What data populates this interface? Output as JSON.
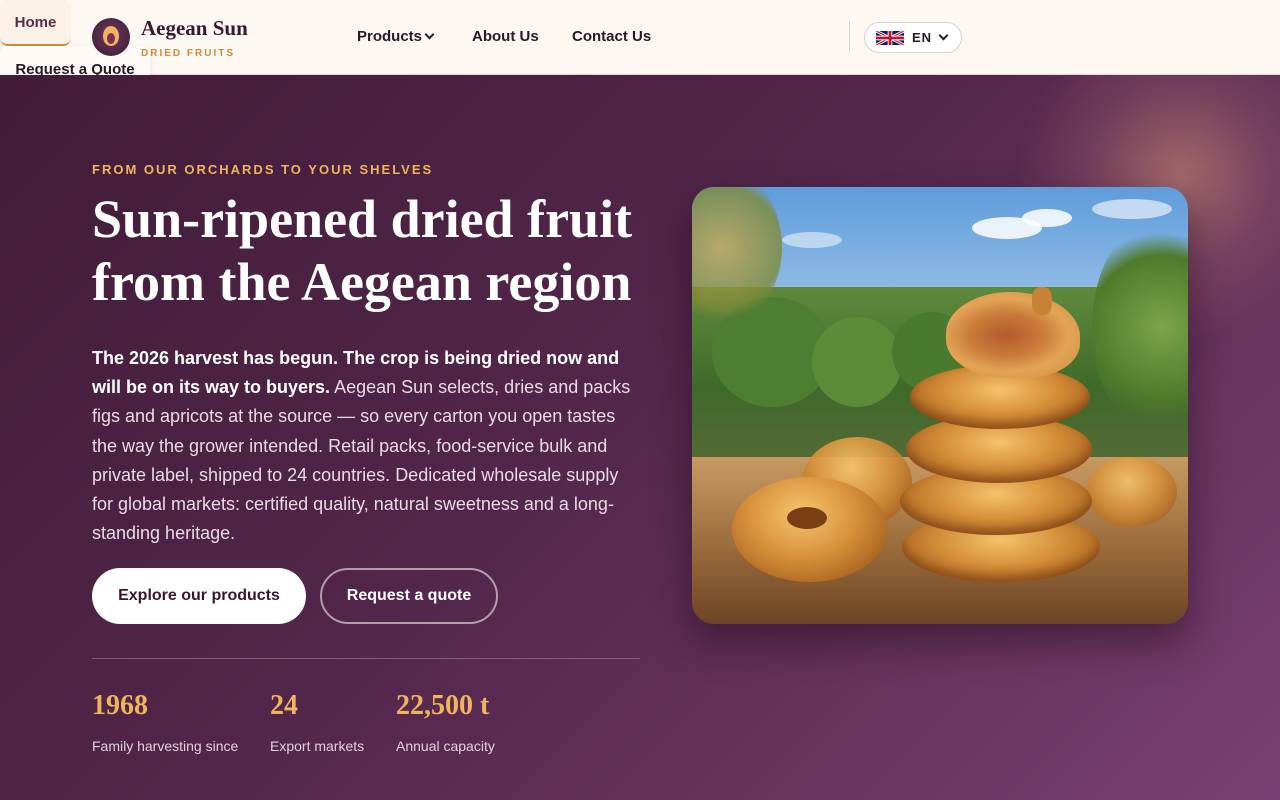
{
  "brand": {
    "name": "Aegean Sun",
    "subtitle": "DRIED FRUITS"
  },
  "nav": {
    "home": "Home",
    "products": "Products",
    "about": "About Us",
    "contact": "Contact Us",
    "quote": "Request a Quote",
    "language": "EN"
  },
  "hero": {
    "eyebrow": "FROM OUR ORCHARDS TO YOUR SHELVES",
    "headline": "Sun-ripened dried fruit from the Aegean region",
    "lead_bold": "The 2026 harvest has begun. The crop is being dried now and will be on its way to buyers.",
    "lead_rest": " Aegean Sun selects, dries and packs figs and apricots at the source — so every carton you open tastes the way the grower intended. Retail packs, food-service bulk and private label, shipped to 24 countries. Dedicated wholesale supply for global markets: certified quality, natural sweetness and a long-standing heritage.",
    "cta_primary": "Explore our products",
    "cta_secondary": "Request a quote"
  },
  "stats": [
    {
      "value": "1968",
      "label": "Family harvesting since"
    },
    {
      "value": "24",
      "label": "Export markets"
    },
    {
      "value": "22,500 t",
      "label": "Annual capacity"
    }
  ],
  "colors": {
    "accent": "#f0b45c",
    "hero_bg_start": "#421c38",
    "hero_bg_end": "#7a3f72",
    "header_bg": "#fdf8f2"
  }
}
